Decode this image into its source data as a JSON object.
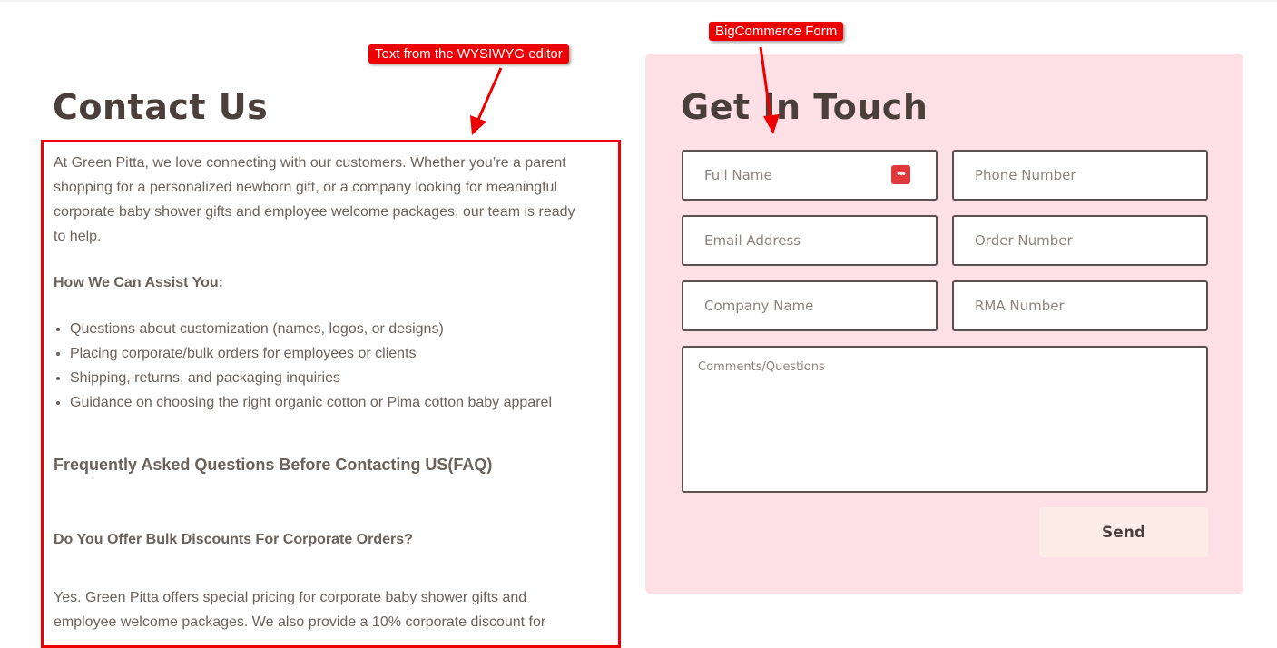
{
  "contact": {
    "title": "Contact Us",
    "intro": "At Green Pitta, we love connecting with our customers. Whether you’re a parent shopping for a personalized newborn gift, or a company looking for meaningful corporate baby shower gifts and employee welcome packages, our team is ready to help.",
    "assist_heading": "How We Can Assist You:",
    "assist_items": [
      "Questions about customization (names, logos, or designs)",
      "Placing corporate/bulk orders for employees or clients",
      "Shipping, returns, and packaging inquiries",
      "Guidance on choosing the right organic cotton or Pima cotton baby apparel"
    ],
    "faq_heading": "Frequently Asked Questions Before Contacting US(FAQ)",
    "bulk_question": "Do You Offer Bulk Discounts For Corporate Orders?",
    "bulk_answer": "Yes. Green Pitta offers special pricing for corporate baby shower gifts and employee welcome packages. We also provide a 10% corporate discount for"
  },
  "annotations": {
    "editor": "Text from the WYSIWYG editor",
    "form": "BigCommerce Form"
  },
  "form": {
    "title": "Get In Touch",
    "full_name_placeholder": "Full Name",
    "phone_placeholder": "Phone Number",
    "email_placeholder": "Email Address",
    "order_placeholder": "Order Number",
    "company_placeholder": "Company Name",
    "rma_placeholder": "RMA Number",
    "comments_placeholder": "Comments/Questions",
    "send_label": "Send",
    "password_icon": "password-manager-icon"
  },
  "colors": {
    "annotation_red": "#ee0000",
    "form_panel_bg": "#fde0e6",
    "heading": "#4a3f3b",
    "body_text": "#6b625c",
    "send_button_bg": "#fcece8"
  }
}
